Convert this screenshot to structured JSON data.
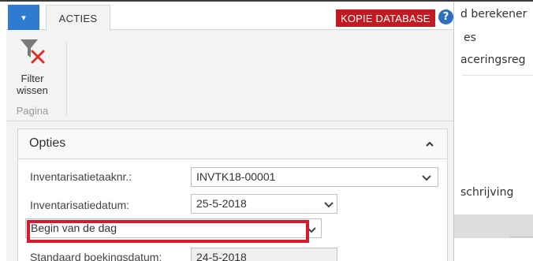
{
  "ribbon": {
    "app_button_symbol": "▾",
    "tab_label": "ACTIES",
    "badge_label": "KOPIE DATABASE",
    "badge_color": "#c21a23",
    "help_symbol": "?",
    "filter_line1": "Filter",
    "filter_line2": "wissen",
    "group_label": "Pagina"
  },
  "options": {
    "title": "Opties",
    "chevron_symbol": "⌃",
    "fields": [
      {
        "label": "Inventarisatietaaknr.:",
        "value": "INVTK18-00001"
      },
      {
        "label": "Inventarisatiedatum:",
        "value": "25-5-2018"
      },
      {
        "label": "",
        "value": "Begin van de dag"
      },
      {
        "label": "Standaard boekingsdatum:",
        "value": "24-5-2018"
      }
    ]
  },
  "background_page": {
    "line1": "d berekener",
    "line2": "es",
    "line3": "aceringsreg",
    "line4": "schrijving"
  },
  "colors": {
    "accent_blue": "#2f7bd0",
    "highlight_red": "#d7192b"
  }
}
